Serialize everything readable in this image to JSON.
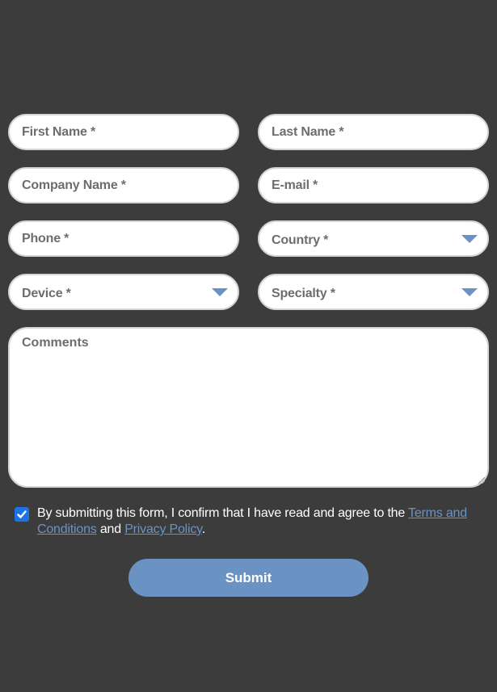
{
  "form": {
    "fields": {
      "first_name": "First Name *",
      "last_name": "Last Name *",
      "company_name": "Company Name *",
      "email": "E-mail *",
      "phone": "Phone *",
      "country": "Country *",
      "device": "Device *",
      "specialty": "Specialty *",
      "comments": "Comments"
    },
    "consent": {
      "checked": true,
      "text_before": "By submitting this form, I confirm that I have read and agree to the ",
      "terms_link": "Terms and Conditions",
      "text_middle": " and ",
      "privacy_link": "Privacy Policy",
      "text_after": "."
    },
    "submit_label": "Submit"
  },
  "colors": {
    "background": "#3c3c3c",
    "accent": "#6a93c4",
    "checkbox": "#1a73e8",
    "placeholder_text": "#6d6d6d"
  },
  "icons": {
    "dropdown": "caret-down-icon",
    "checkbox": "checkmark-icon"
  }
}
